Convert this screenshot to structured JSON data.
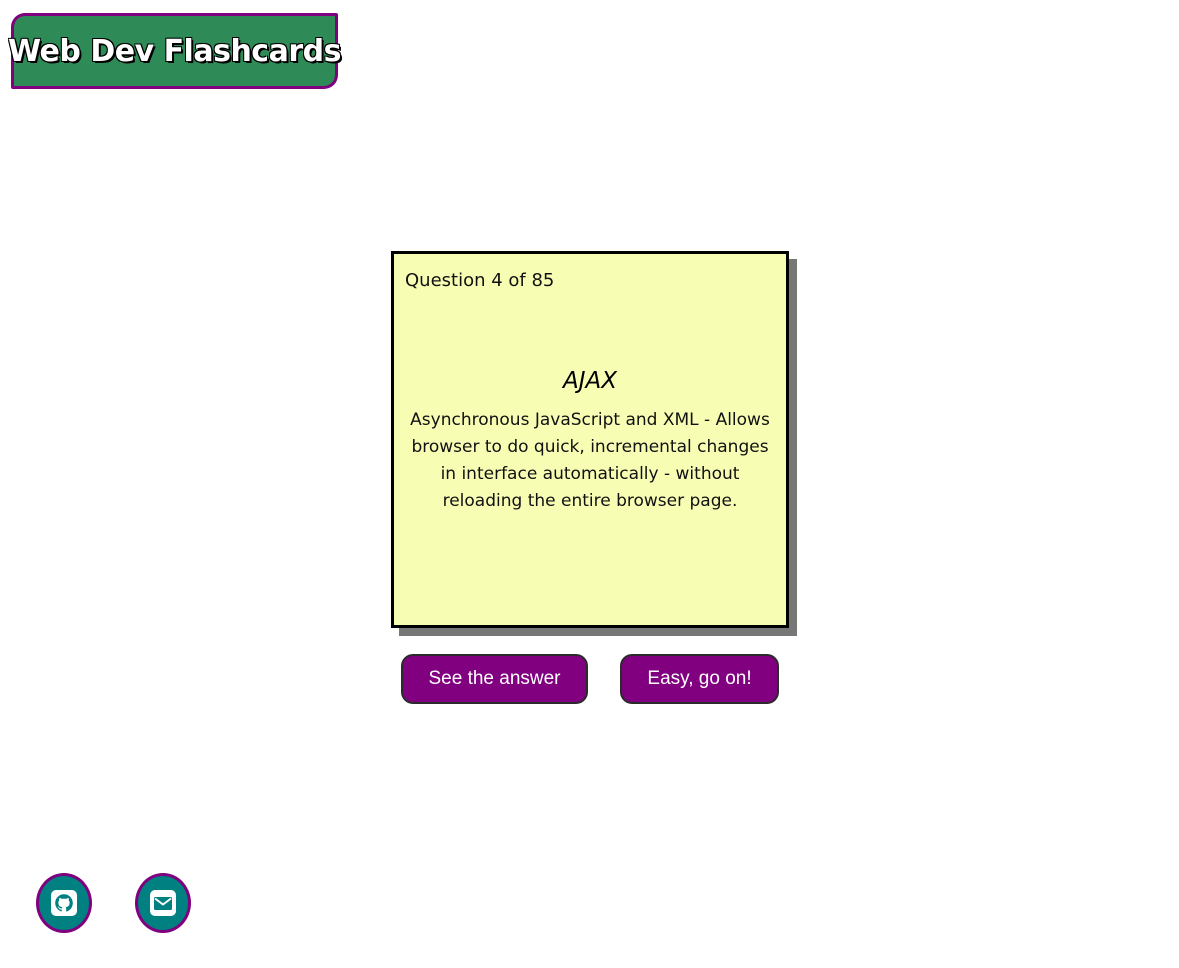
{
  "header": {
    "title": "Web Dev Flashcards"
  },
  "card": {
    "counter": "Question 4 of 85",
    "term": "AJAX",
    "definition": "Asynchronous JavaScript and XML - Allows browser to do quick, incremental changes in interface automatically - without reloading the entire browser page."
  },
  "actions": {
    "see_answer_label": "See the answer",
    "next_label": "Easy, go on!"
  },
  "footer": {
    "icons": [
      "github-icon",
      "envelope-icon"
    ]
  },
  "colors": {
    "accent": "#800080",
    "title_background": "#2e8b57",
    "card_background": "#f8fdb4",
    "icon_background": "#008080"
  }
}
